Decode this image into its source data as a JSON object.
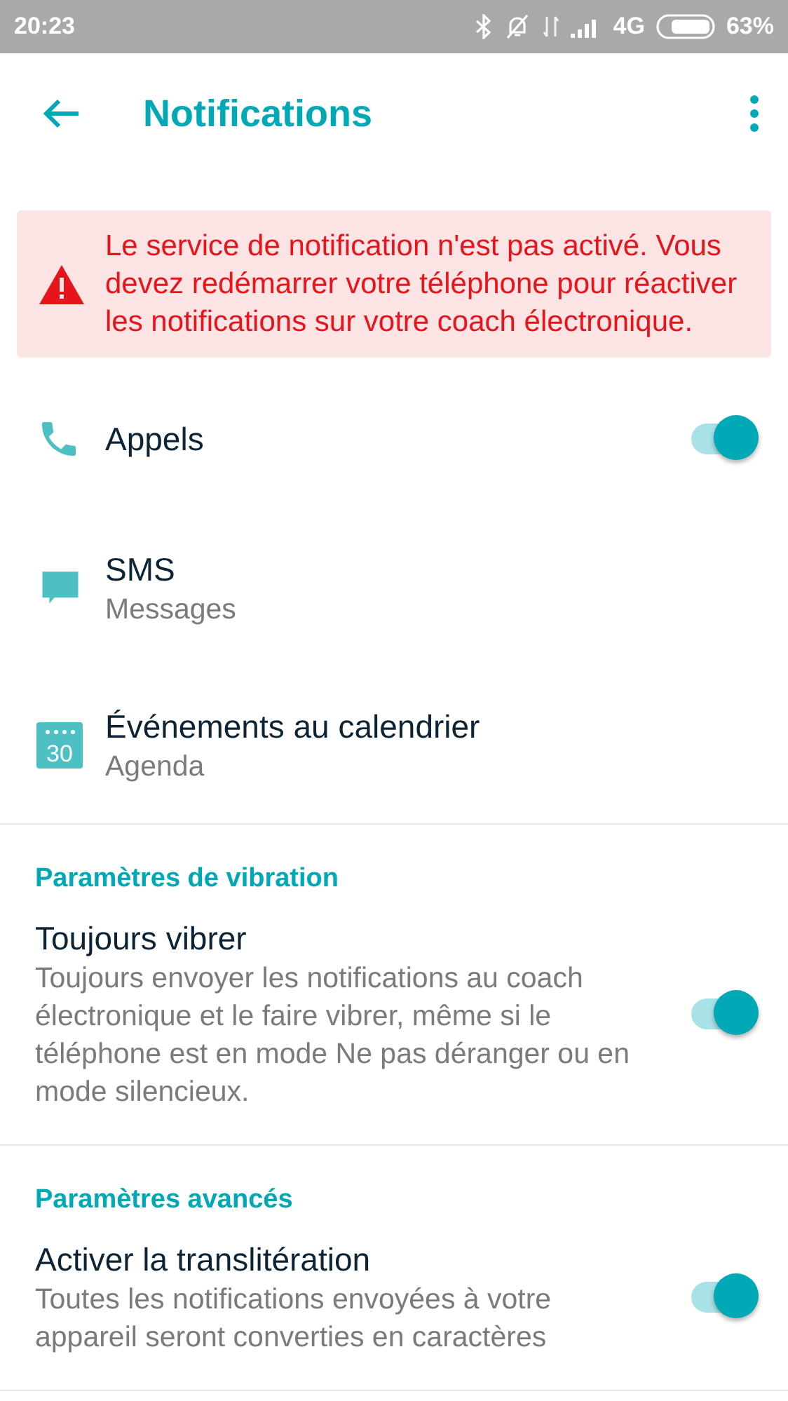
{
  "status_bar": {
    "time": "20:23",
    "network": "4G",
    "battery": "63%"
  },
  "header": {
    "title": "Notifications"
  },
  "alert": {
    "text": "Le service de notification n'est pas activé. Vous devez redémarrer votre téléphone pour réactiver les notifications sur votre coach électronique."
  },
  "apps": [
    {
      "kind": "phone",
      "title": "Appels",
      "on": true
    },
    {
      "kind": "message",
      "title": "SMS",
      "subtitle": "Messages"
    },
    {
      "kind": "calendar",
      "title": "Événements au calendrier",
      "subtitle": "Agenda",
      "icon_text": "30"
    }
  ],
  "sections": [
    {
      "header": "Paramètres de vibration",
      "items": [
        {
          "title": "Toujours vibrer",
          "description": "Toujours envoyer les notifications au coach électronique et le faire vibrer, même si le téléphone est en mode Ne pas déranger ou en mode silencieux.",
          "on": true
        }
      ]
    },
    {
      "header": "Paramètres avancés",
      "items": [
        {
          "title": "Activer la translitération",
          "description": "Toutes les notifications envoyées à votre appareil seront converties en caractères",
          "on": true
        }
      ]
    }
  ]
}
